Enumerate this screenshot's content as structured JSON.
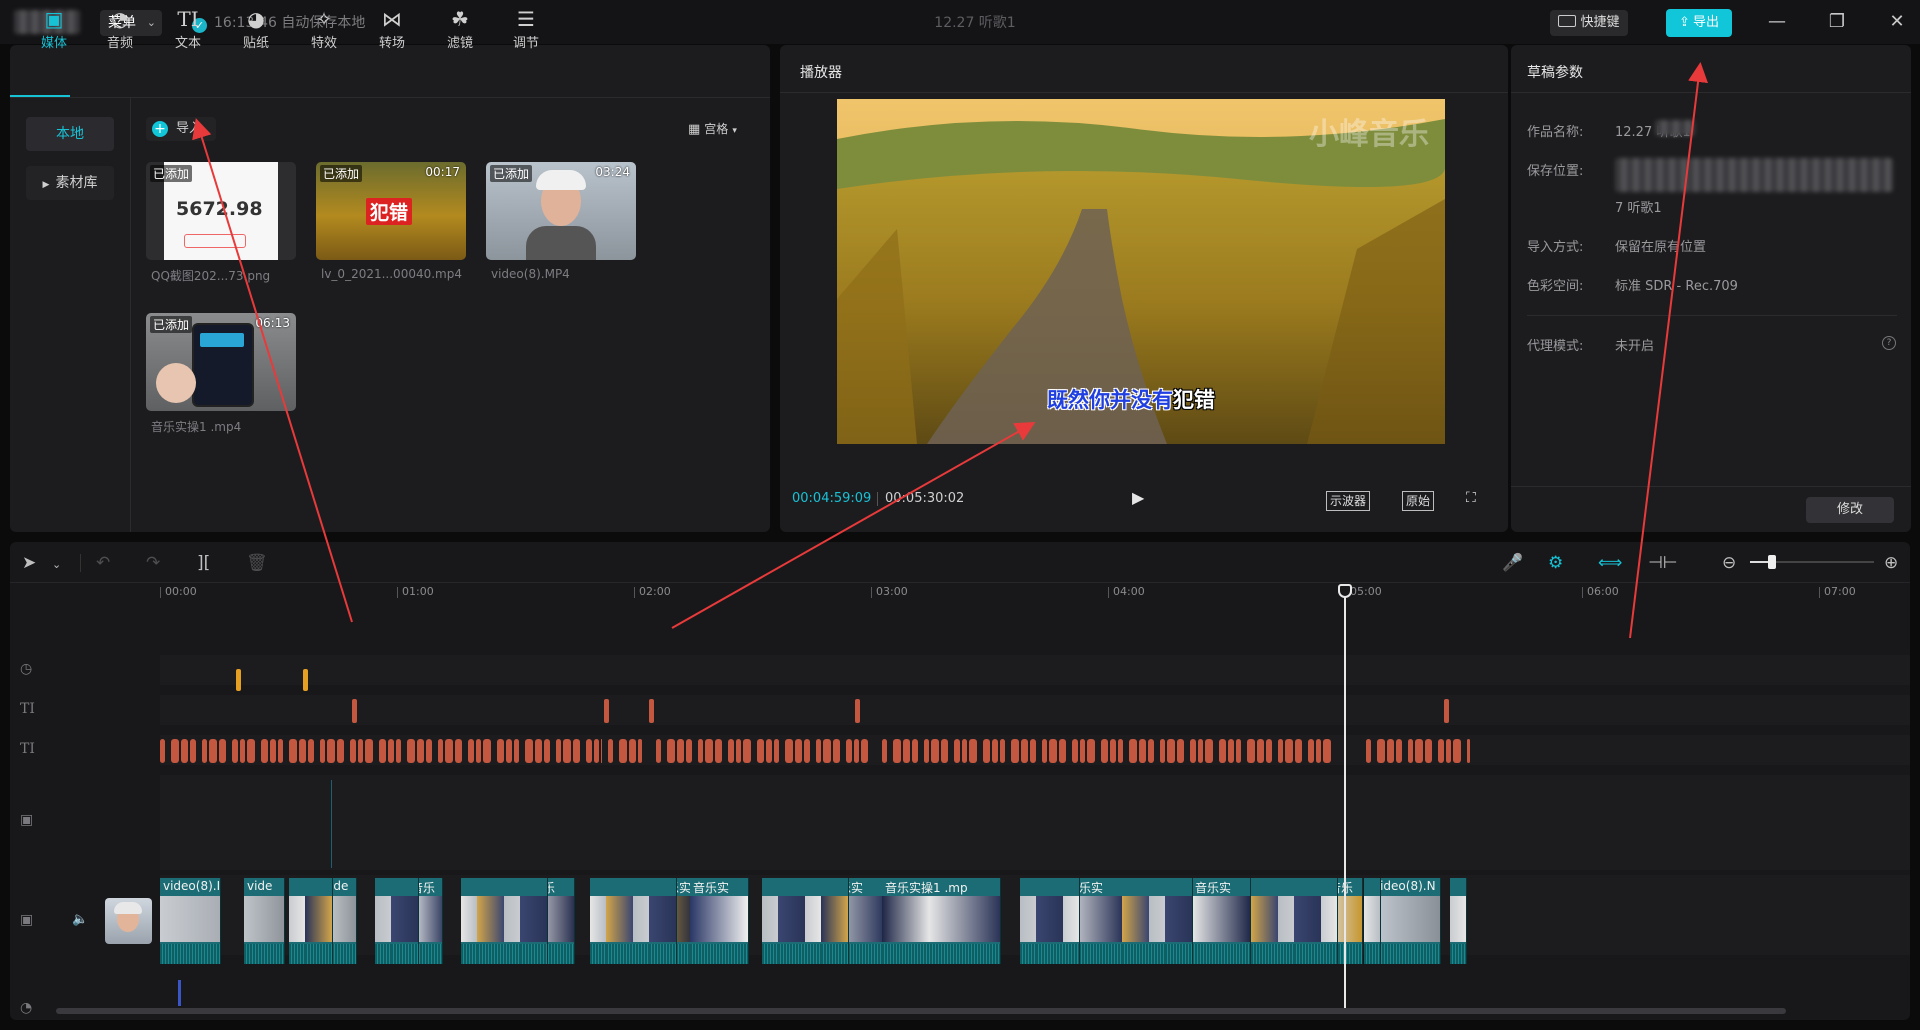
{
  "titlebar": {
    "menu_label": "菜单",
    "save_status": "16:13:46 自动保存本地",
    "project_title": "12.27 听歌1",
    "shortcut_label": "快捷键",
    "export_label": "导出",
    "minimize": "—",
    "restore": "❐",
    "close": "✕"
  },
  "media_tools": [
    {
      "label": "媒体",
      "icon": "media-icon"
    },
    {
      "label": "音频",
      "icon": "audio-icon"
    },
    {
      "label": "文本",
      "icon": "text-icon"
    },
    {
      "label": "贴纸",
      "icon": "sticker-icon"
    },
    {
      "label": "特效",
      "icon": "effects-icon"
    },
    {
      "label": "转场",
      "icon": "transition-icon"
    },
    {
      "label": "滤镜",
      "icon": "filter-icon"
    },
    {
      "label": "调节",
      "icon": "adjust-icon"
    }
  ],
  "media": {
    "side_local": "本地",
    "side_library": "素材库",
    "import_label": "导入",
    "view_mode": "宫格",
    "items": [
      {
        "badge": "已添加",
        "duration": "",
        "name": "QQ截图202...73.png",
        "big_text": "5672.98"
      },
      {
        "badge": "已添加",
        "duration": "00:17",
        "name": "lv_0_2021...00040.mp4",
        "big_text": "犯错"
      },
      {
        "badge": "已添加",
        "duration": "03:24",
        "name": "video(8).MP4",
        "big_text": ""
      },
      {
        "badge": "已添加",
        "duration": "06:13",
        "name": "音乐实操1 .mp4",
        "big_text": ""
      }
    ]
  },
  "player": {
    "title": "播放器",
    "watermark": "小峰音乐",
    "subtitle_part1": "既然你并没有",
    "subtitle_part2": "犯错",
    "time_current": "00:04:59:09",
    "time_total": "00:05:30:02",
    "btn_scope": "示波器",
    "btn_original": "原始"
  },
  "params": {
    "title": "草稿参数",
    "rows": [
      {
        "label": "作品名称:",
        "value": "12.27 听歌1"
      },
      {
        "label": "保存位置:",
        "value": "7 听歌1"
      },
      {
        "label": "导入方式:",
        "value": "保留在原有位置"
      },
      {
        "label": "色彩空间:",
        "value": "标准 SDR - Rec.709"
      },
      {
        "label": "代理模式:",
        "value": "未开启"
      }
    ],
    "modify_label": "修改"
  },
  "timeline": {
    "ruler": [
      "00:00",
      "01:00",
      "02:00",
      "03:00",
      "04:00",
      "05:00",
      "06:00",
      "07:00"
    ],
    "playhead_time": "05:00",
    "clip_labels": [
      "video(8).I",
      "vide",
      "vide",
      "音乐",
      "音乐实",
      "音乐实操1 .mp",
      "音乐实",
      "音乐",
      "video(8).N"
    ]
  },
  "colors": {
    "accent": "#18c2d5",
    "panel": "#1c1c1f",
    "text_clip": "#c4573f",
    "marker": "#e5a024",
    "video_clip": "#1b6c74",
    "annotation_arrow": "#e83a3a"
  }
}
